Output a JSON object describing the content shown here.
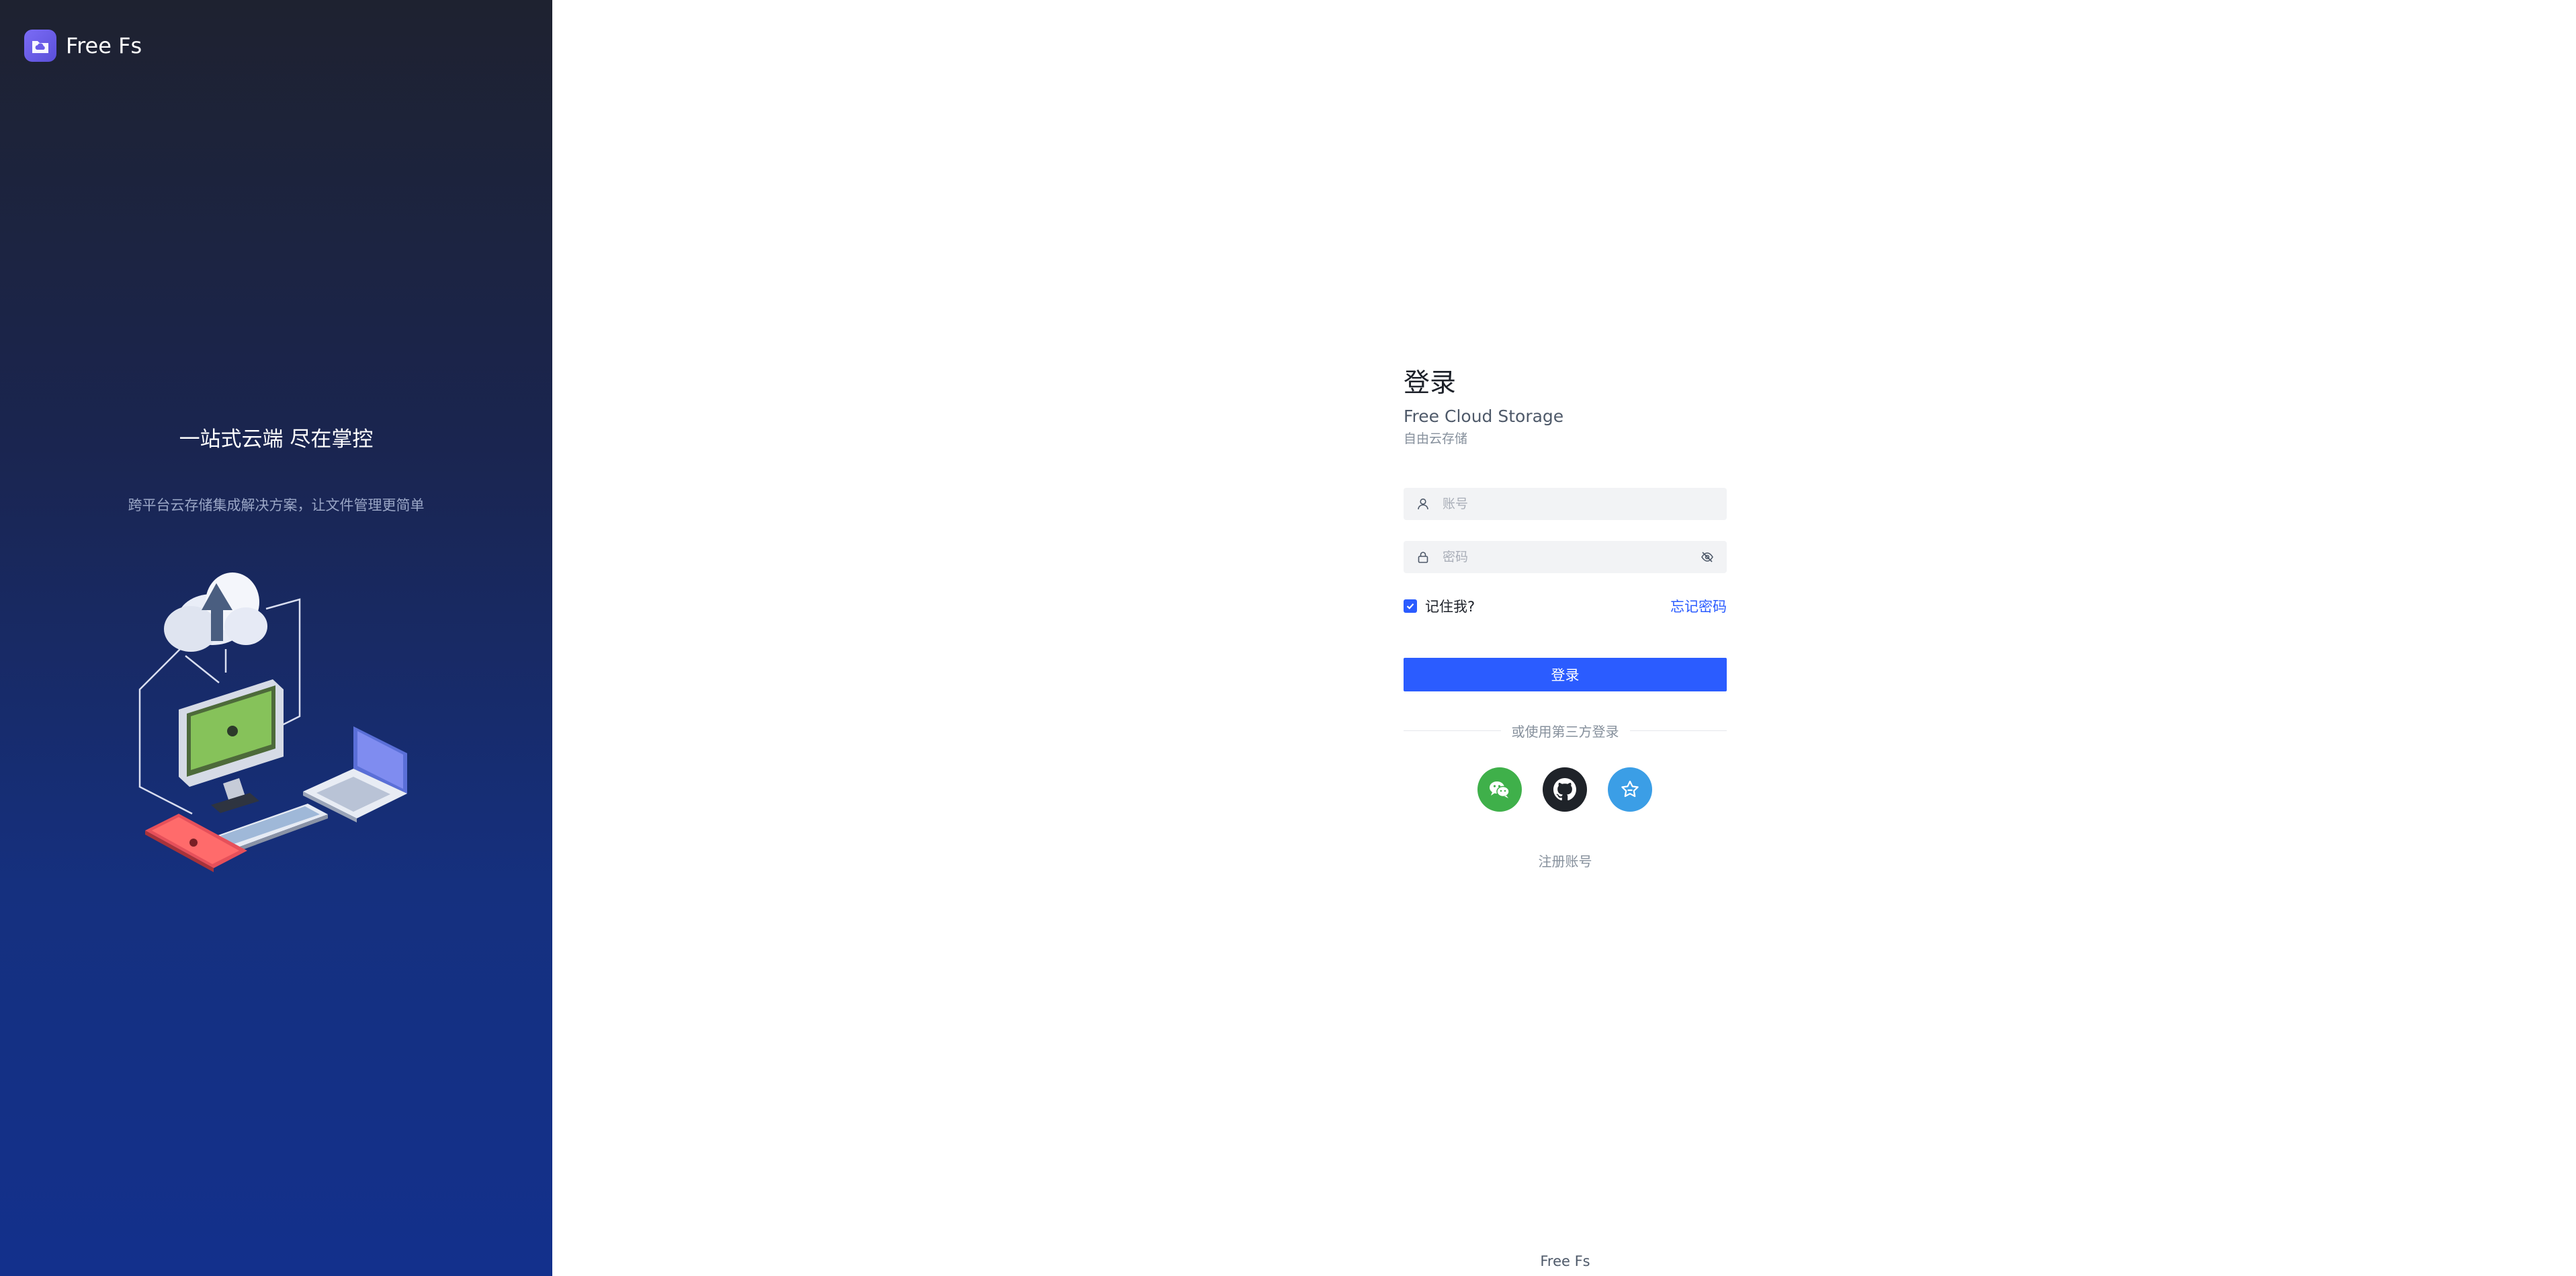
{
  "brand": {
    "name": "Free Fs",
    "logo_icon": "cloud-folder-icon"
  },
  "left": {
    "title": "一站式云端 尽在掌控",
    "subtitle": "跨平台云存储集成解决方案，让文件管理更简单"
  },
  "login": {
    "title": "登录",
    "subtitle_en": "Free Cloud Storage",
    "subtitle_cn": "自由云存储",
    "username_placeholder": "账号",
    "password_placeholder": "密码",
    "remember_label": "记住我?",
    "remember_checked": true,
    "forgot_label": "忘记密码",
    "submit_label": "登录",
    "divider_text": "或使用第三方登录",
    "register_label": "注册账号"
  },
  "social": [
    {
      "name": "wechat",
      "icon": "wechat-icon",
      "color": "#3fb04a"
    },
    {
      "name": "github",
      "icon": "github-icon",
      "color": "#1f2329"
    },
    {
      "name": "gitee",
      "icon": "gitee-icon",
      "color": "#3b9ee6"
    }
  ],
  "footer": {
    "text": "Free Fs"
  },
  "colors": {
    "primary": "#2b5cff",
    "panel_top": "#1e2230",
    "panel_bottom": "#13308c"
  }
}
